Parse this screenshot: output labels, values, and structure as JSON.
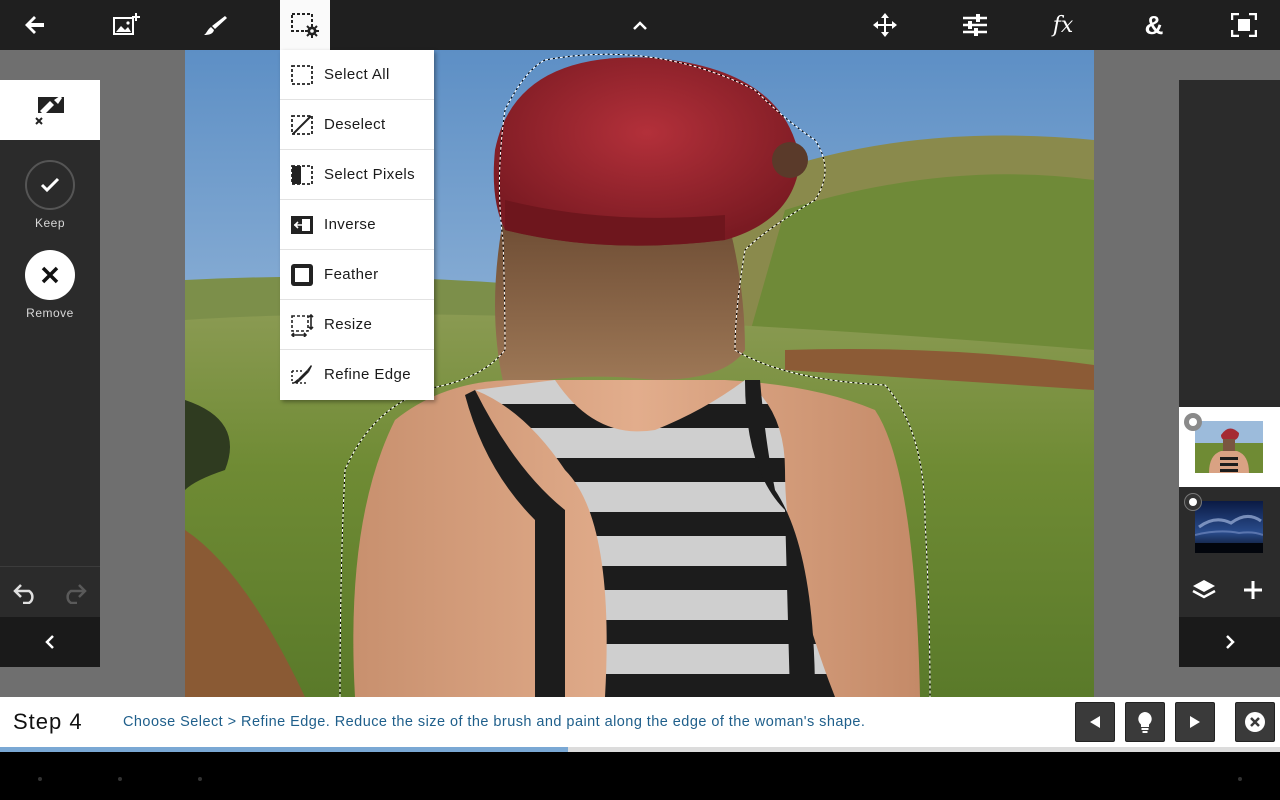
{
  "menu": {
    "items": [
      {
        "label": "Select All",
        "icon": "select-all-icon"
      },
      {
        "label": "Deselect",
        "icon": "deselect-icon"
      },
      {
        "label": "Select Pixels",
        "icon": "select-pixels-icon"
      },
      {
        "label": "Inverse",
        "icon": "inverse-icon"
      },
      {
        "label": "Feather",
        "icon": "feather-icon"
      },
      {
        "label": "Resize",
        "icon": "resize-icon"
      },
      {
        "label": "Refine Edge",
        "icon": "refine-edge-icon"
      }
    ]
  },
  "left_panel": {
    "keep_label": "Keep",
    "remove_label": "Remove"
  },
  "tutorial": {
    "step_title": "Step 4",
    "instruction": "Choose Select > Refine Edge. Reduce the size of the brush and paint along the edge of the woman's shape.",
    "progress": 0.444
  },
  "colors": {
    "toolbar": "#1f1f1f",
    "panel": "#2b2b2b",
    "instruction_text": "#1f5f8b",
    "progress_fill": "#7aa8d4"
  }
}
